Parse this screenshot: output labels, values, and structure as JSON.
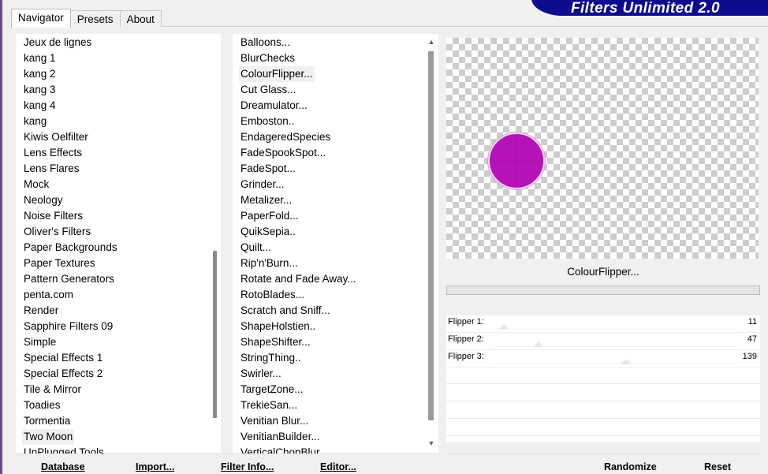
{
  "app": {
    "title": "Filters Unlimited 2.0"
  },
  "tabs": [
    "Navigator",
    "Presets",
    "About"
  ],
  "categories": [
    "Jeux de lignes",
    "kang 1",
    "kang 2",
    "kang 3",
    "kang 4",
    "kang",
    "Kiwis Oelfilter",
    "Lens Effects",
    "Lens Flares",
    "Mock",
    "Neology",
    "Noise Filters",
    "Oliver's Filters",
    "Paper Backgrounds",
    "Paper Textures",
    "Pattern Generators",
    "penta.com",
    "Render",
    "Sapphire Filters 09",
    "Simple",
    "Special Effects 1",
    "Special Effects 2",
    "Tile & Mirror",
    "Toadies",
    "Tormentia",
    "Two Moon",
    "UnPlugged Tools"
  ],
  "categories_selected": "Two Moon",
  "filters": [
    "Balloons...",
    "BlurChecks",
    "ColourFlipper...",
    "Cut Glass...",
    "Dreamulator...",
    "Emboston..",
    "EndageredSpecies",
    "FadeSpookSpot...",
    "FadeSpot...",
    "Grinder...",
    "Metalizer...",
    "PaperFold...",
    "QuikSepia..",
    "Quilt...",
    "Rip'n'Burn...",
    "Rotate and Fade Away...",
    "RotoBlades...",
    "Scratch and Sniff...",
    "ShapeHolstien..",
    "ShapeShifter...",
    "StringThing..",
    "Swirler...",
    "TargetZone...",
    "TrekieSan...",
    "Venitian Blur...",
    "VenitianBuilder...",
    "VerticalChopBlur..."
  ],
  "filters_selected": "ColourFlipper...",
  "preview": {
    "selected_filter": "ColourFlipper...",
    "shape_color": "#b512b8"
  },
  "params": [
    {
      "label": "Flipper 1:",
      "value": "11",
      "max": 255
    },
    {
      "label": "Flipper 2:",
      "value": "47",
      "max": 255
    },
    {
      "label": "Flipper 3:",
      "value": "139",
      "max": 255
    }
  ],
  "buttons": {
    "database": "Database",
    "import": "Import...",
    "filter_info": "Filter Info...",
    "editor": "Editor...",
    "randomize": "Randomize",
    "reset": "Reset"
  }
}
